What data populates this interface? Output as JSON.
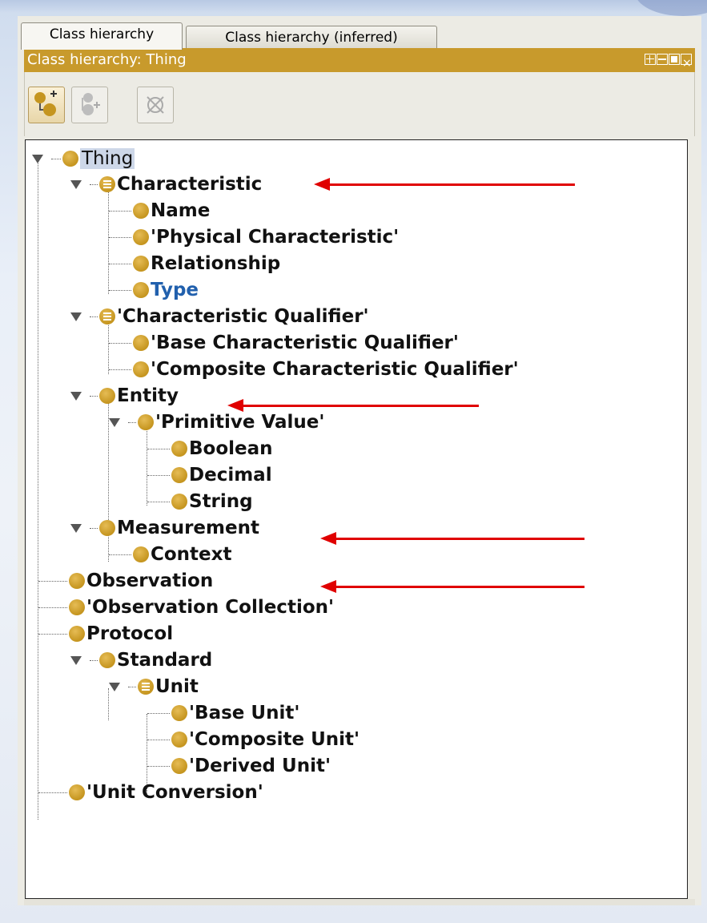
{
  "tabs": [
    {
      "label": "Class hierarchy",
      "active": true
    },
    {
      "label": "Class hierarchy (inferred)",
      "active": false
    }
  ],
  "view": {
    "title": "Class hierarchy: Thing"
  },
  "toolbar": {
    "add_subclass_icon": "add-subclass-icon",
    "add_sibling_icon": "add-sibling-class-icon",
    "delete_icon": "delete-class-icon"
  },
  "tree": {
    "root": "Thing",
    "nodes": [
      {
        "label": "Characteristic",
        "level": 1,
        "icon": "defined-class-icon",
        "expanded": true,
        "annotated": true
      },
      {
        "label": "Name",
        "level": 2,
        "icon": "class-icon"
      },
      {
        "label": "'Physical Characteristic'",
        "level": 2,
        "icon": "class-icon"
      },
      {
        "label": "Relationship",
        "level": 2,
        "icon": "class-icon"
      },
      {
        "label": "Type",
        "level": 2,
        "icon": "class-icon",
        "style": "blue"
      },
      {
        "label": "'Characteristic Qualifier'",
        "level": 1,
        "icon": "defined-class-icon",
        "expanded": true
      },
      {
        "label": "'Base Characteristic Qualifier'",
        "level": 2,
        "icon": "class-icon"
      },
      {
        "label": "'Composite Characteristic Qualifier'",
        "level": 2,
        "icon": "class-icon"
      },
      {
        "label": "Entity",
        "level": 1,
        "icon": "class-icon",
        "expanded": true,
        "annotated": true
      },
      {
        "label": "'Primitive Value'",
        "level": 2,
        "icon": "class-icon",
        "expanded": true
      },
      {
        "label": "Boolean",
        "level": 3,
        "icon": "class-icon"
      },
      {
        "label": "Decimal",
        "level": 3,
        "icon": "class-icon"
      },
      {
        "label": "String",
        "level": 3,
        "icon": "class-icon"
      },
      {
        "label": "Measurement",
        "level": 1,
        "icon": "class-icon",
        "expanded": true,
        "annotated": true
      },
      {
        "label": "Context",
        "level": 2,
        "icon": "class-icon"
      },
      {
        "label": "Observation",
        "level": 1,
        "icon": "class-icon",
        "annotated": true
      },
      {
        "label": "'Observation Collection'",
        "level": 1,
        "icon": "class-icon"
      },
      {
        "label": "Protocol",
        "level": 1,
        "icon": "class-icon"
      },
      {
        "label": "Standard",
        "level": 1,
        "icon": "class-icon",
        "expanded": true
      },
      {
        "label": "Unit",
        "level": 2,
        "icon": "defined-class-icon",
        "expanded": true
      },
      {
        "label": "'Base Unit'",
        "level": 3,
        "icon": "class-icon"
      },
      {
        "label": "'Composite Unit'",
        "level": 3,
        "icon": "class-icon"
      },
      {
        "label": "'Derived Unit'",
        "level": 3,
        "icon": "class-icon"
      },
      {
        "label": "'Unit Conversion'",
        "level": 1,
        "icon": "class-icon"
      }
    ]
  },
  "colors": {
    "accent": "#c89a2c",
    "class_dot": "#c5951f",
    "annotation_arrow": "#e00000",
    "selected_bg": "#cdd7e8",
    "link_blue": "#2160ad"
  }
}
